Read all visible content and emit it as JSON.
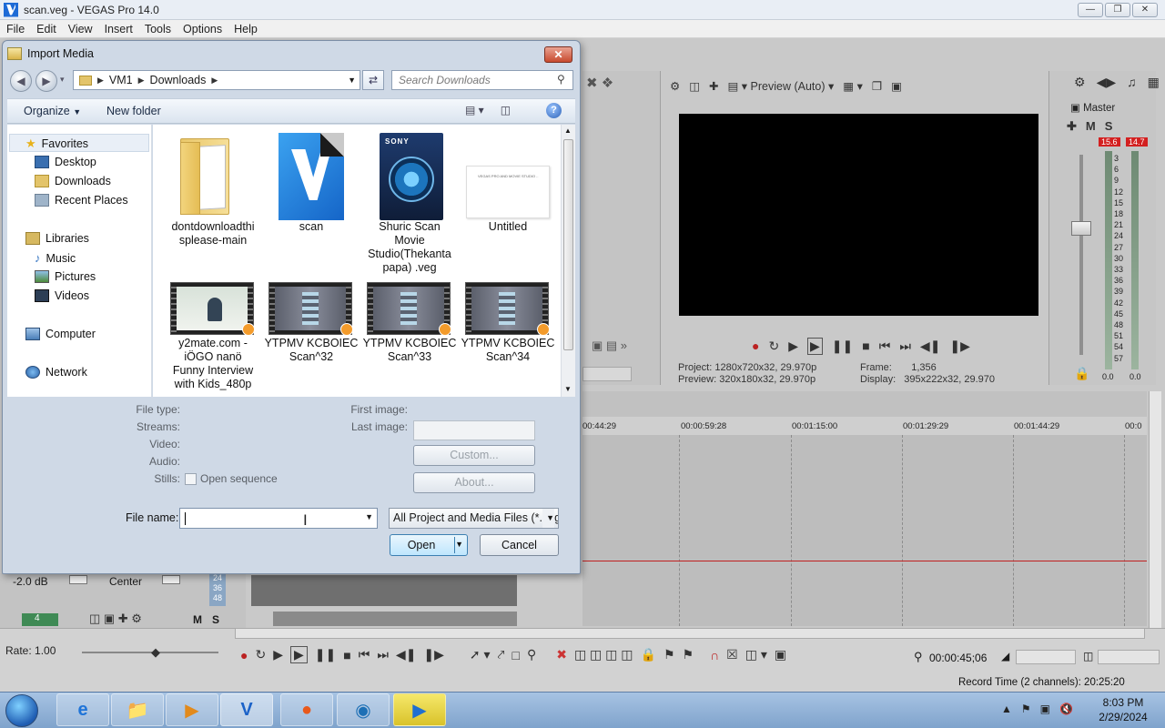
{
  "window": {
    "title": "scan.veg - VEGAS Pro 14.0",
    "controls": [
      "—",
      "❐",
      "✕"
    ]
  },
  "menu": [
    "File",
    "Edit",
    "View",
    "Insert",
    "Tools",
    "Options",
    "Help"
  ],
  "preview": {
    "mode": "Preview (Auto)",
    "info": {
      "project_label": "Project:",
      "project_value": "1280x720x32, 29.970p",
      "preview_label": "Preview:",
      "preview_value": "320x180x32, 29.970p",
      "frame_label": "Frame:",
      "frame_value": "1,356",
      "display_label": "Display:",
      "display_value": "395x222x32, 29.970"
    }
  },
  "master": {
    "label": "Master",
    "mute": "M",
    "solo": "S",
    "peak_left": "15.6",
    "peak_right": "14.7",
    "scale": [
      "3",
      "6",
      "9",
      "12",
      "15",
      "18",
      "21",
      "24",
      "27",
      "30",
      "33",
      "36",
      "39",
      "42",
      "45",
      "48",
      "51",
      "54",
      "57"
    ],
    "bottom_left": "0.0",
    "bottom_right": "0.0"
  },
  "timeline": {
    "ticks": [
      "00:44:29",
      "00:00:59:28",
      "00:01:15:00",
      "00:01:29:29",
      "00:01:44:29",
      "00:0"
    ],
    "timecode": "00:00:45;06",
    "record_time": "Record Time (2 channels): 20:25:20",
    "rate": "Rate: 1.00",
    "track": {
      "volume": "-2.0 dB",
      "pan": "Center",
      "number": "4",
      "mute": "M",
      "solo": "S",
      "levels": [
        "24",
        "36",
        "48"
      ]
    }
  },
  "taskbar": {
    "time": "8:03 PM",
    "date": "2/29/2024"
  },
  "dialog": {
    "title": "Import Media",
    "breadcrumb": [
      "VM1",
      "Downloads"
    ],
    "search_placeholder": "Search Downloads",
    "organize": "Organize",
    "new_folder": "New folder",
    "nav": {
      "favorites": "Favorites",
      "desktop": "Desktop",
      "downloads": "Downloads",
      "recent": "Recent Places",
      "libraries": "Libraries",
      "music": "Music",
      "pictures": "Pictures",
      "videos": "Videos",
      "computer": "Computer",
      "network": "Network"
    },
    "files": [
      {
        "name": "dontdownloadthisplease-main",
        "line1": "dontdownloadthi",
        "line2": "splease-main",
        "kind": "folder"
      },
      {
        "name": "scan",
        "line1": "scan",
        "line2": "",
        "kind": "vegas"
      },
      {
        "name": "Shuric Scan Movie Studio(Thekantapapa) .veg",
        "line1": "Shuric Scan",
        "line2": "Movie",
        "line3": "Studio(Thekanta",
        "line4": "papa) .veg",
        "kind": "sony"
      },
      {
        "name": "Untitled",
        "line1": "Untitled",
        "line2": "",
        "kind": "image"
      },
      {
        "name": "y2mate.com - iÖGO nanö Funny Interview with Kids_480p",
        "line1": "y2mate.com -",
        "line2": "iÖGO nanö",
        "line3": "Funny Interview",
        "line4": "with Kids_480p",
        "kind": "video"
      },
      {
        "name": "YTPMV KCBOIEC Scan^32",
        "line1": "YTPMV KCBOIEC",
        "line2": "Scan^32",
        "kind": "video"
      },
      {
        "name": "YTPMV KCBOIEC Scan^33",
        "line1": "YTPMV KCBOIEC",
        "line2": "Scan^33",
        "kind": "video"
      },
      {
        "name": "YTPMV KCBOIEC Scan^34",
        "line1": "YTPMV KCBOIEC",
        "line2": "Scan^34",
        "kind": "video"
      }
    ],
    "details": {
      "file_type": "File type:",
      "streams": "Streams:",
      "video": "Video:",
      "audio": "Audio:",
      "stills": "Stills:",
      "open_sequence": "Open sequence",
      "first_image": "First image:",
      "last_image": "Last image:",
      "custom": "Custom...",
      "about": "About..."
    },
    "file_name_label": "File name:",
    "file_name_value": "",
    "file_type_filter": "All Project and Media Files (*.veg",
    "open": "Open",
    "cancel": "Cancel"
  }
}
